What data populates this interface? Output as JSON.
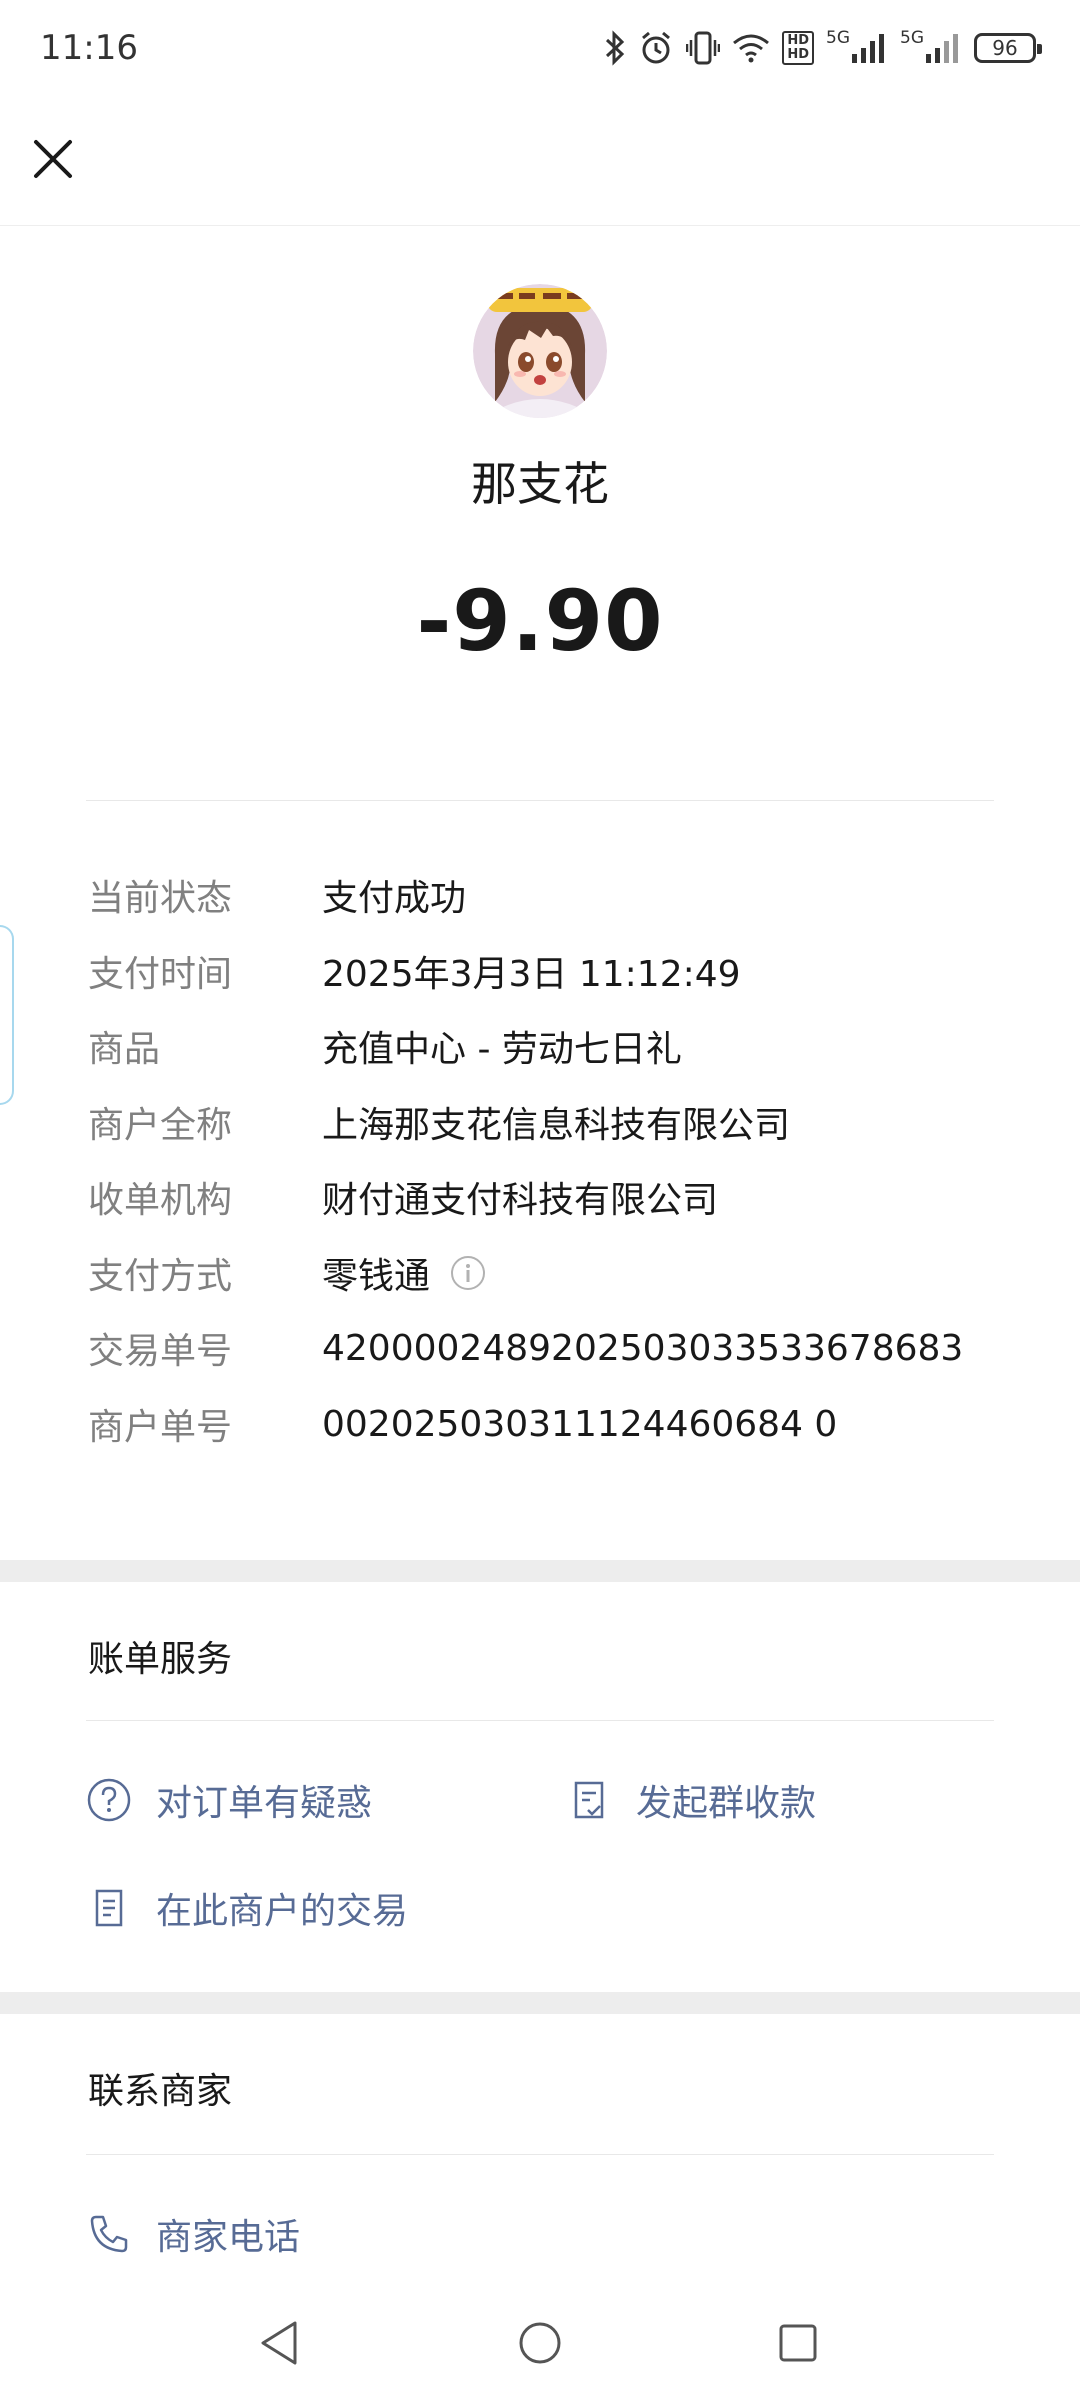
{
  "status_bar": {
    "time": "11:16",
    "hd_label": "HD1\nHD2",
    "net1_label": "5G",
    "net2_label": "5G",
    "battery": "96"
  },
  "header": {
    "close_icon": "close-icon"
  },
  "merchant": {
    "name": "那支花",
    "amount": "-9.90"
  },
  "details": [
    {
      "label": "当前状态",
      "value": "支付成功"
    },
    {
      "label": "支付时间",
      "value": "2025年3月3日 11:12:49"
    },
    {
      "label": "商品",
      "value": "充值中心 - 劳动七日礼"
    },
    {
      "label": "商户全称",
      "value": "上海那支花信息科技有限公司"
    },
    {
      "label": "收单机构",
      "value": "财付通支付科技有限公司"
    },
    {
      "label": "支付方式",
      "value": "零钱通"
    },
    {
      "label": "交易单号",
      "value": "4200002489202503033533678683"
    },
    {
      "label": "商户单号",
      "value": "002025030311124460684 0"
    }
  ],
  "bill_service": {
    "title": "账单服务",
    "actions": [
      {
        "label": "对订单有疑惑",
        "icon": "question-circle-icon"
      },
      {
        "label": "发起群收款",
        "icon": "checklist-icon"
      },
      {
        "label": "在此商户的交易",
        "icon": "document-icon"
      }
    ]
  },
  "contact": {
    "title": "联系商家",
    "phone_label": "商家电话",
    "phone_icon": "phone-icon"
  },
  "colors": {
    "link": "#576b95",
    "label_gray": "#808080",
    "band_gray": "#ededed"
  }
}
